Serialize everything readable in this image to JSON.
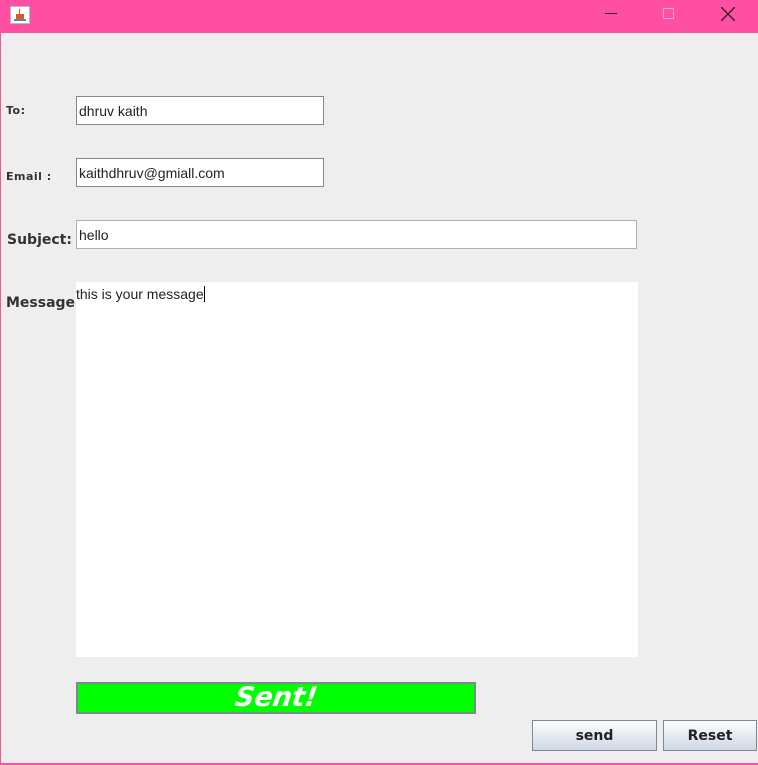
{
  "window": {
    "minimize_icon": "minimize-icon",
    "maximize_icon": "maximize-icon",
    "close_icon": "close-icon",
    "title_bar_color": "#ff4fa2"
  },
  "form": {
    "to_label": "To:",
    "to_value": "dhruv kaith",
    "email_label": "Email :",
    "email_value": "kaithdhruv@gmiall.com",
    "subject_label": "Subject:",
    "subject_value": "hello",
    "message_label": "Message:",
    "message_value": "this is your message"
  },
  "status": {
    "text": "Sent!",
    "background": "#00ff00"
  },
  "buttons": {
    "send": "send",
    "reset": "Reset"
  }
}
